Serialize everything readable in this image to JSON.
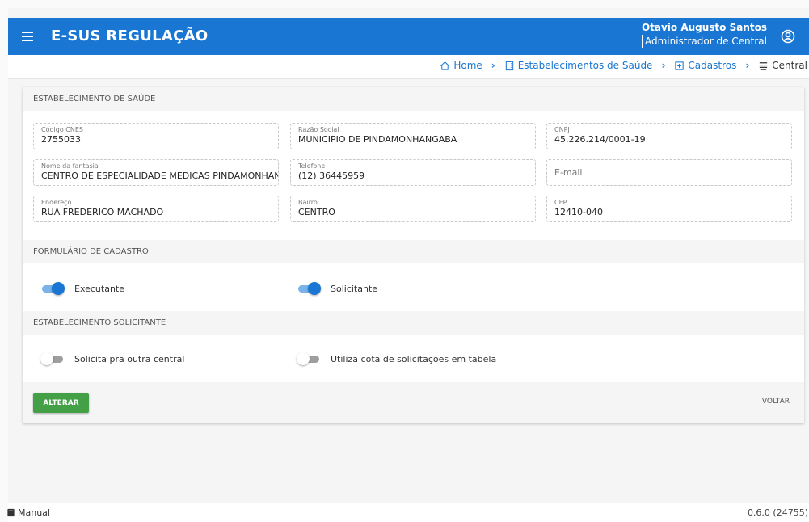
{
  "app": {
    "title": "E-SUS REGULAÇÃO",
    "user_name": "Otavio Augusto Santos",
    "user_role": "Administrador de Central"
  },
  "breadcrumb": [
    {
      "label": "Home",
      "icon": "home-icon"
    },
    {
      "label": "Estabelecimentos de Saúde",
      "icon": "building-icon"
    },
    {
      "label": "Cadastros",
      "icon": "plus-box-icon"
    },
    {
      "label": "Central",
      "icon": "server-icon"
    }
  ],
  "sections": {
    "estabelecimento": "ESTABELECIMENTO DE SAÚDE",
    "formulario": "FORMULÁRIO DE CADASTRO",
    "solicitante": "ESTABELECIMENTO SOLICITANTE"
  },
  "fields": {
    "cnes": {
      "label": "Código CNES",
      "value": "2755033"
    },
    "razao_social": {
      "label": "Razão Social",
      "value": "MUNICIPIO DE PINDAMONHANGABA"
    },
    "cnpj": {
      "label": "CNPJ",
      "value": "45.226.214/0001-19"
    },
    "nome_fantasia": {
      "label": "Nome da fantasia",
      "value": "CENTRO DE ESPECIALIDADE MEDICAS PINDAMONHAN"
    },
    "telefone": {
      "label": "Telefone",
      "value": "(12) 36445959"
    },
    "email": {
      "placeholder": "E-mail"
    },
    "endereco": {
      "label": "Endereço",
      "value": "RUA FREDERICO MACHADO"
    },
    "bairro": {
      "label": "Bairro",
      "value": "CENTRO"
    },
    "cep": {
      "label": "CEP",
      "value": "12410-040"
    }
  },
  "toggles": {
    "executante": {
      "label": "Executante",
      "on": true
    },
    "solicitante": {
      "label": "Solicitante",
      "on": true
    },
    "outra_central": {
      "label": "Solicita pra outra central",
      "on": false
    },
    "cota": {
      "label": "Utiliza cota de solicitações em tabela",
      "on": false
    }
  },
  "actions": {
    "alterar": "ALTERAR",
    "voltar": "VOLTAR"
  },
  "footer": {
    "manual": "Manual",
    "version": "0.6.0 (24755)"
  },
  "colors": {
    "primary": "#1976d2",
    "success": "#43a047",
    "background": "#f5f5f5"
  }
}
